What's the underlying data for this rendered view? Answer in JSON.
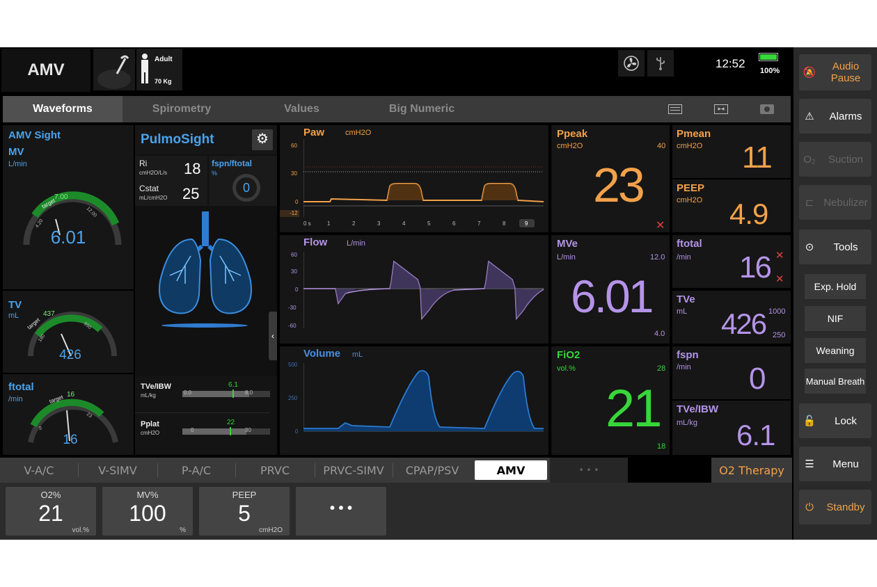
{
  "topbar": {
    "mode": "AMV",
    "patient_type": "Adult",
    "weight": "70 Kg",
    "time": "12:52",
    "battery": "100%",
    "icons": [
      "fan-icon",
      "usb-icon",
      "battery-icon"
    ]
  },
  "tabs": [
    "Waveforms",
    "Spirometry",
    "Values",
    "Big Numeric"
  ],
  "tab_icons": [
    "layout-icon",
    "freeze-icon",
    "camera-icon"
  ],
  "amv_sight": {
    "title": "AMV Sight",
    "mv": {
      "name": "MV",
      "unit": "L/min",
      "value": "6.01",
      "target_label": "target",
      "target": "7.00",
      "low": "4.20",
      "high": "12.00"
    },
    "tv": {
      "name": "TV",
      "unit": "mL",
      "value": "426",
      "target_label": "target",
      "target": "437",
      "low": "180",
      "high": "950"
    },
    "ftotal": {
      "name": "ftotal",
      "unit": "/min",
      "value": "16",
      "target_label": "target",
      "target": "16",
      "low": "5",
      "high": "23"
    }
  },
  "pulmo": {
    "title": "PulmoSight",
    "ri_label": "Ri",
    "ri_unit": "cmH2O/L/s",
    "ri_value": "18",
    "cstat_label": "Cstat",
    "cstat_unit": "mL/cmH2O",
    "cstat_value": "25",
    "fspn_label": "fspn/ftotal",
    "fspn_unit": "%",
    "fspn_value": "0",
    "tve_label": "TVe/IBW",
    "tve_unit": "mL/kg",
    "tve_value": "6.1",
    "tve_min": "0.0",
    "tve_max": "8.0",
    "tve_frac": 0.76,
    "pplat_label": "Pplat",
    "pplat_unit": "cmH2O",
    "pplat_value": "22",
    "pplat_min": "0",
    "pplat_max": "30",
    "pplat_frac": 0.73
  },
  "waves": {
    "paw": {
      "name": "Paw",
      "unit": "cmH2O",
      "yticks": [
        "60",
        "30",
        "0",
        "-12"
      ],
      "xticks": [
        "0 s",
        "1",
        "2",
        "3",
        "4",
        "5",
        "6",
        "7",
        "8",
        "9"
      ]
    },
    "flow": {
      "name": "Flow",
      "unit": "L/min",
      "yticks": [
        "60",
        "30",
        "0",
        "-30",
        "-60"
      ]
    },
    "volume": {
      "name": "Volume",
      "unit": "mL",
      "yticks": [
        "500",
        "250",
        "0"
      ]
    }
  },
  "params": {
    "ppeak": {
      "name": "Ppeak",
      "unit": "cmH2O",
      "value": "23",
      "high": "40"
    },
    "pmean": {
      "name": "Pmean",
      "unit": "cmH2O",
      "value": "11"
    },
    "peep": {
      "name": "PEEP",
      "unit": "cmH2O",
      "value": "4.9"
    },
    "mve": {
      "name": "MVe",
      "unit": "L/min",
      "value": "6.01",
      "high": "12.0",
      "low": "4.0"
    },
    "ftotal": {
      "name": "ftotal",
      "unit": "/min",
      "value": "16"
    },
    "tve": {
      "name": "TVe",
      "unit": "mL",
      "value": "426",
      "high": "1000",
      "low": "250"
    },
    "fio2": {
      "name": "FiO2",
      "unit": "vol.%",
      "value": "21",
      "high": "28",
      "low": "18"
    },
    "fspn": {
      "name": "fspn",
      "unit": "/min",
      "value": "0"
    },
    "tveibw": {
      "name": "TVe/IBW",
      "unit": "mL/kg",
      "value": "6.1"
    }
  },
  "sidebar": {
    "audio_pause": "Audio Pause",
    "alarms": "Alarms",
    "suction": "Suction",
    "nebulizer": "Nebulizer",
    "tools": "Tools",
    "exp_hold": "Exp. Hold",
    "nif": "NIF",
    "weaning": "Weaning",
    "manual_breath": "Manual Breath",
    "lock": "Lock",
    "menu": "Menu",
    "standby": "Standby"
  },
  "modes": [
    "V-A/C",
    "V-SIMV",
    "P-A/C",
    "PRVC",
    "PRVC-SIMV",
    "CPAP/PSV",
    "AMV",
    "• • •"
  ],
  "o2_therapy": "O2 Therapy",
  "settings": [
    {
      "name": "O2%",
      "value": "21",
      "unit": "vol.%"
    },
    {
      "name": "MV%",
      "value": "100",
      "unit": "%"
    },
    {
      "name": "PEEP",
      "value": "5",
      "unit": "cmH2O"
    }
  ],
  "more_settings": "• • •",
  "colors": {
    "paw": "#f3a14a",
    "flow": "#b594e8",
    "volume": "#1e6fb8",
    "fio2": "#37d63a",
    "amv": "#4aa3ee"
  }
}
